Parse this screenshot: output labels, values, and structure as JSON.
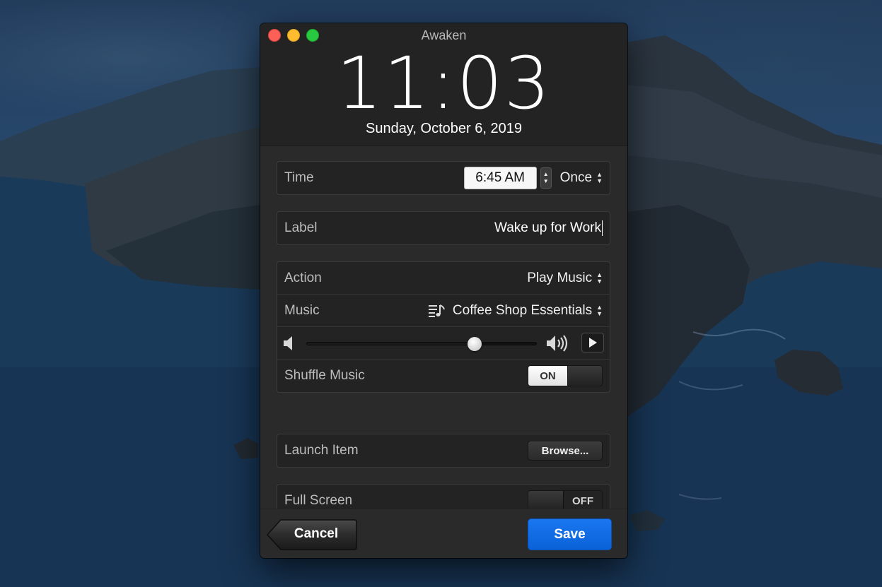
{
  "window": {
    "title": "Awaken",
    "clock": "11:03",
    "date": "Sunday, October 6, 2019"
  },
  "time_row": {
    "label": "Time",
    "value": "6:45 AM",
    "repeat": "Once"
  },
  "label_row": {
    "label": "Label",
    "value": "Wake up for Work"
  },
  "action_row": {
    "label": "Action",
    "value": "Play Music"
  },
  "music_row": {
    "label": "Music",
    "value": "Coffee Shop Essentials",
    "icon": "playlist-icon"
  },
  "volume_row": {
    "level": 0.73,
    "low_icon": "volume-low-icon",
    "high_icon": "volume-high-icon",
    "play_icon": "play-icon"
  },
  "shuffle_row": {
    "label": "Shuffle Music",
    "toggle": "ON",
    "state": true
  },
  "launch_row": {
    "label": "Launch Item",
    "button": "Browse..."
  },
  "fullscreen_row": {
    "label": "Full Screen",
    "toggle": "OFF",
    "state": false
  },
  "footer": {
    "cancel": "Cancel",
    "save": "Save"
  },
  "colors": {
    "accent": "#0a62d8",
    "close": "#fe5f57",
    "minimize": "#febc2e",
    "maximize": "#28c840"
  }
}
